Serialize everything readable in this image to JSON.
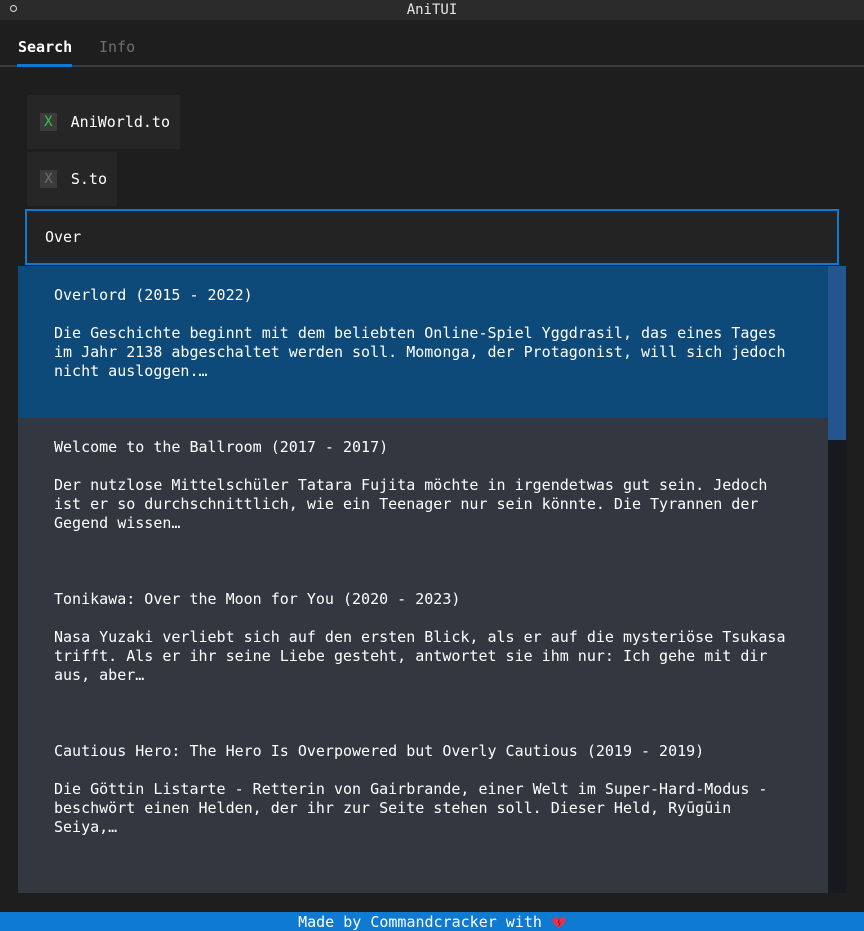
{
  "app": {
    "title": "AniTUI"
  },
  "tabs": [
    {
      "label": "Search",
      "active": true
    },
    {
      "label": "Info",
      "active": false
    }
  ],
  "sources": [
    {
      "label": "AniWorld.to",
      "checked": true,
      "mark": "X"
    },
    {
      "label": "S.to",
      "checked": false,
      "mark": "X"
    }
  ],
  "search": {
    "value": "Over"
  },
  "results": [
    {
      "title": "Overlord (2015 - 2022)",
      "description": "Die Geschichte beginnt mit dem beliebten Online-Spiel Yggdrasil, das eines Tages\nim Jahr 2138 abgeschaltet werden soll. Momonga, der Protagonist, will sich jedoch\nnicht ausloggen.…",
      "selected": true
    },
    {
      "title": "Welcome to the Ballroom (2017 - 2017)",
      "description": "Der nutzlose Mittelschüler Tatara Fujita möchte in irgendetwas gut sein. Jedoch\nist er so durchschnittlich, wie ein Teenager nur sein könnte. Die Tyrannen der\nGegend wissen…",
      "selected": false
    },
    {
      "title": "Tonikawa: Over the Moon for You (2020 - 2023)",
      "description": "Nasa Yuzaki verliebt sich auf den ersten Blick, als er auf die mysteriöse Tsukasa\ntrifft. Als er ihr seine Liebe gesteht, antwortet sie ihm nur: Ich gehe mit dir\naus, aber…",
      "selected": false
    },
    {
      "title": "Cautious Hero: The Hero Is Overpowered but Overly Cautious (2019 - 2019)",
      "description": "Die Göttin Listarte - Retterin von Gairbrande, einer Welt im Super-Hard-Modus -\nbeschwört einen Helden, der ihr zur Seite stehen soll. Dieser Held, Ryūgūin\nSeiya,…",
      "selected": false
    }
  ],
  "footer": {
    "text": "Made by Commandcracker with",
    "icon": "heart-icon"
  },
  "colors": {
    "accent": "#0e7ad1",
    "selected": "#0d4a7a",
    "checked": "#35c34a"
  }
}
